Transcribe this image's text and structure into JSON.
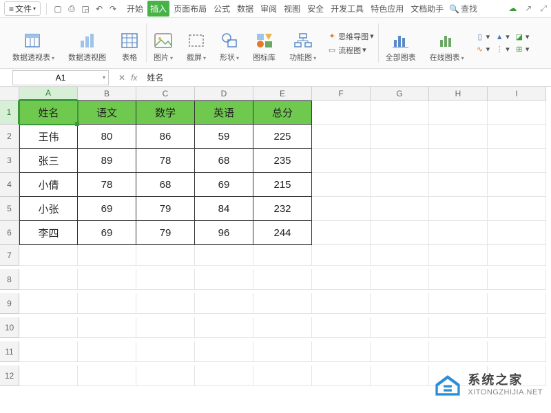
{
  "menubar": {
    "file_label": "文件",
    "tabs": [
      "开始",
      "插入",
      "页面布局",
      "公式",
      "数据",
      "审阅",
      "视图",
      "安全",
      "开发工具",
      "特色应用",
      "文档助手"
    ],
    "active_tab_index": 1,
    "search_label": "查找"
  },
  "ribbon": {
    "groups": [
      {
        "label": "数据透视表"
      },
      {
        "label": "数据透视图"
      },
      {
        "label": "表格"
      },
      {
        "label": "图片"
      },
      {
        "label": "截屏"
      },
      {
        "label": "形状"
      },
      {
        "label": "图标库"
      },
      {
        "label": "功能图"
      }
    ],
    "mini1": {
      "r1": "思维导图",
      "r2": "流程图"
    },
    "groups2": [
      {
        "label": "全部图表"
      },
      {
        "label": "在线图表"
      }
    ]
  },
  "fxbar": {
    "cell_ref": "A1",
    "fx_label": "fx",
    "formula_value": "姓名"
  },
  "columns": [
    "A",
    "B",
    "C",
    "D",
    "E",
    "F",
    "G",
    "H",
    "I"
  ],
  "selected_col_index": 0,
  "selected_row_index": 0,
  "chart_data": {
    "type": "table",
    "headers": [
      "姓名",
      "语文",
      "数学",
      "英语",
      "总分"
    ],
    "rows": [
      [
        "王伟",
        80,
        86,
        59,
        225
      ],
      [
        "张三",
        89,
        78,
        68,
        235
      ],
      [
        "小倩",
        78,
        68,
        69,
        215
      ],
      [
        "小张",
        69,
        79,
        84,
        232
      ],
      [
        "李四",
        69,
        79,
        96,
        244
      ]
    ]
  },
  "empty_rows": [
    7,
    8,
    9,
    10,
    11,
    12
  ],
  "watermark": {
    "title": "系统之家",
    "url": "XITONGZHIJIA.NET"
  }
}
